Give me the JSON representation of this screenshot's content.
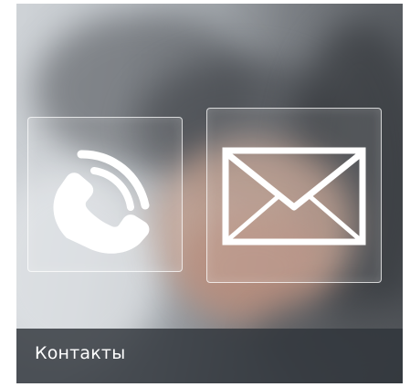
{
  "banner": {
    "caption": "Контакты",
    "icons": [
      "phone-icon",
      "mail-icon"
    ],
    "colors": {
      "caption_bar": "#30343a",
      "icon_stroke": "#ffffff"
    }
  }
}
